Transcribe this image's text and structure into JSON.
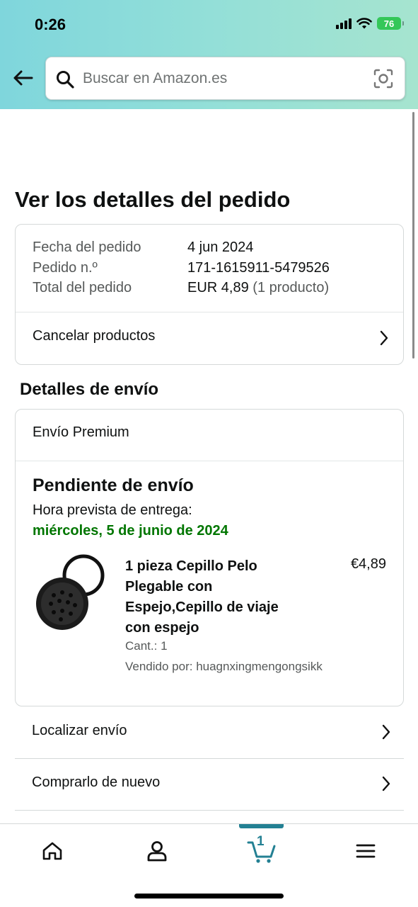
{
  "status_bar": {
    "time": "0:26",
    "battery": "76"
  },
  "search": {
    "placeholder": "Buscar en Amazon.es"
  },
  "page": {
    "title": "Ver los detalles del pedido"
  },
  "order_summary": {
    "rows": [
      {
        "label": "Fecha del pedido",
        "value": "4 jun 2024"
      },
      {
        "label": "Pedido n.º",
        "value": "171-1615911-5479526"
      },
      {
        "label": "Total del pedido",
        "value": "EUR 4,89",
        "extra": "(1 producto)"
      }
    ],
    "cancel_label": "Cancelar productos"
  },
  "shipping": {
    "section_title": "Detalles de envío",
    "method": "Envío Premium",
    "status": "Pendiente de envío",
    "eta_label": "Hora prevista de entrega:",
    "eta_date": "miércoles, 5 de junio de 2024",
    "product": {
      "title": "1 pieza Cepillo Pelo Plegable con Espejo,Cepillo de viaje con espejo",
      "price": "€4,89",
      "qty": "Cant.: 1",
      "seller": "Vendido por: huagnxingmengongsikk"
    }
  },
  "actions": [
    {
      "label": "Localizar envío"
    },
    {
      "label": "Comprarlo de nuevo"
    }
  ],
  "bottom_nav": {
    "items": [
      "home-icon",
      "account-icon",
      "cart-icon",
      "menu-icon"
    ],
    "cart_count": "1",
    "active": "cart"
  },
  "colors": {
    "accent": "#238093",
    "eta_green": "#007600",
    "header_from": "#7fd6dc",
    "header_to": "#a6e4cf"
  }
}
